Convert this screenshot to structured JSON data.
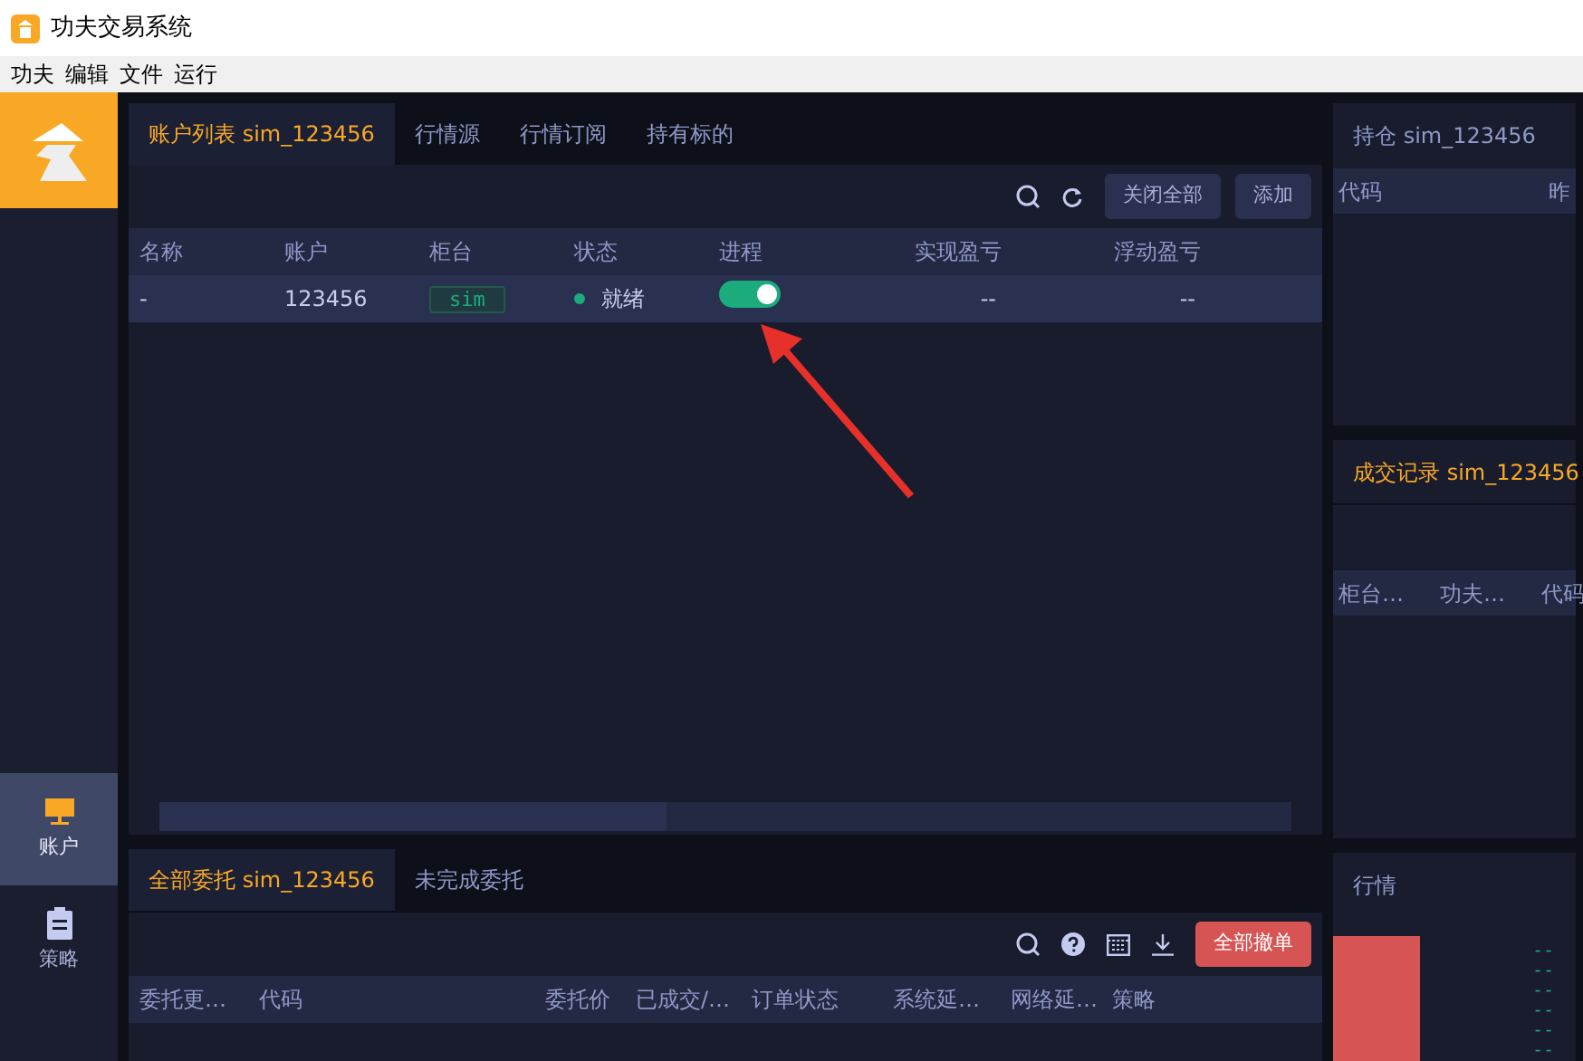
{
  "window": {
    "title": "功夫交易系统"
  },
  "menu": [
    "功夫",
    "编辑",
    "文件",
    "运行"
  ],
  "sidebar": {
    "items": [
      {
        "label": "账户",
        "selected": true
      },
      {
        "label": "策略",
        "selected": false
      }
    ]
  },
  "accounts": {
    "tabs": [
      {
        "label": "账户列表 sim_123456",
        "selected": true
      },
      {
        "label": "行情源",
        "selected": false
      },
      {
        "label": "行情订阅",
        "selected": false
      },
      {
        "label": "持有标的",
        "selected": false
      }
    ],
    "buttons": [
      "关闭全部",
      "添加"
    ],
    "columns": [
      "名称",
      "账户",
      "柜台",
      "状态",
      "进程",
      "实现盈亏",
      "浮动盈亏"
    ],
    "rows": [
      {
        "name": "-",
        "account": "123456",
        "counter": "sim",
        "status": "就绪",
        "color": "#1bab7d",
        "process_on": true,
        "realized": "--",
        "floating": "--"
      }
    ]
  },
  "orders": {
    "tabs": [
      {
        "label": "全部委托 sim_123456",
        "selected": true
      },
      {
        "label": "未完成委托",
        "selected": false
      }
    ],
    "cancel_button": "全部撤单",
    "columns": [
      "委托更…",
      "代码",
      "委托价",
      "已成交/…",
      "订单状态",
      "系统延…",
      "网络延…",
      "策略"
    ]
  },
  "positions": {
    "title": "持仓 sim_123456",
    "columns": [
      "代码",
      "昨"
    ]
  },
  "trades": {
    "title": "成交记录 sim_123456",
    "columns": [
      "柜台…",
      "功夫…",
      "代码"
    ]
  },
  "market": {
    "title": "行情",
    "values": [
      "--",
      "--",
      "--",
      "--",
      "--",
      "--"
    ]
  }
}
